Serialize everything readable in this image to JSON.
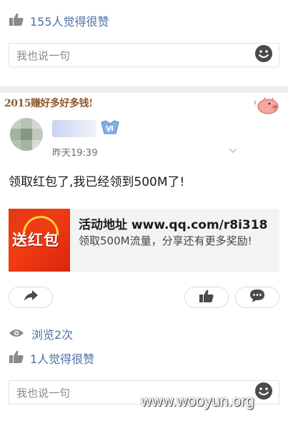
{
  "prev_post": {
    "like_text": "155人觉得很赞",
    "comment_placeholder": "我也说一句"
  },
  "post": {
    "banner_text": "2015赚好多好多钱!",
    "timestamp": "昨天19:39",
    "text": "领取红包了,我已经领到500M了!",
    "share": {
      "thumb_text": "送红包",
      "title": "活动地址 www.qq.com/r8i318",
      "desc": "领取500M流量，分享还有更多奖励!"
    },
    "views_text": "浏览2次",
    "like_text": "1人觉得很赞",
    "comment_placeholder": "我也说一句"
  },
  "watermark": "www.wooyun.org",
  "icons": [
    "thumbs-up-icon",
    "smiley-icon",
    "share-arrow-icon",
    "comment-bubble-icon",
    "eye-icon",
    "chevron-down-icon",
    "pig-icon",
    "vip-badge-icon"
  ],
  "colors": {
    "link_blue": "#4d6fa5",
    "separator": "#eeeeee",
    "banner_brown": "#8e5a2a",
    "thumb_red": "#e23a12"
  }
}
